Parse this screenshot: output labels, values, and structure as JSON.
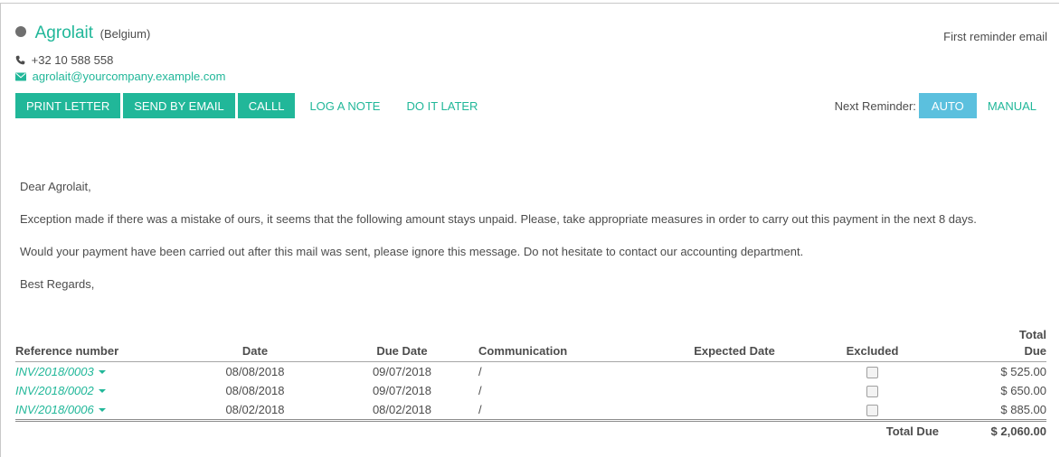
{
  "partner": {
    "name": "Agrolait",
    "country": "(Belgium)",
    "phone": "+32 10 588 558",
    "email": "agrolait@yourcompany.example.com"
  },
  "reminder_level": "First reminder email",
  "actions": {
    "print_letter": "PRINT LETTER",
    "send_by_email": "SEND BY EMAIL",
    "call": "CALLL",
    "log_note": "LOG A NOTE",
    "do_it_later": "DO IT LATER"
  },
  "next_reminder": {
    "label": "Next Reminder:",
    "auto": "AUTO",
    "manual": "MANUAL"
  },
  "letter": {
    "greeting": "Dear Agrolait,",
    "paragraph1": "Exception made if there was a mistake of ours, it seems that the following amount stays unpaid. Please, take appropriate measures in order to carry out this payment in the next 8 days.",
    "paragraph2": "Would your payment have been carried out after this mail was sent, please ignore this message. Do not hesitate to contact our accounting department.",
    "closing": "Best Regards,"
  },
  "table": {
    "headers": {
      "reference": "Reference number",
      "date": "Date",
      "due_date": "Due Date",
      "communication": "Communication",
      "expected_date": "Expected Date",
      "excluded": "Excluded",
      "total_due_line1": "Total",
      "total_due_line2": "Due"
    },
    "rows": [
      {
        "reference": "INV/2018/0003",
        "date": "08/08/2018",
        "due_date": "09/07/2018",
        "communication": "/",
        "expected_date": "",
        "total_due": "$ 525.00"
      },
      {
        "reference": "INV/2018/0002",
        "date": "08/08/2018",
        "due_date": "09/07/2018",
        "communication": "/",
        "expected_date": "",
        "total_due": "$ 650.00"
      },
      {
        "reference": "INV/2018/0006",
        "date": "08/02/2018",
        "due_date": "08/02/2018",
        "communication": "/",
        "expected_date": "",
        "total_due": "$ 885.00"
      }
    ],
    "total_label": "Total Due",
    "total_value": "$ 2,060.00"
  },
  "colors": {
    "accent": "#21b799",
    "info": "#5bc0de",
    "status_dot": "#6f6f6f"
  },
  "icons": {
    "status": "status-dot-icon",
    "phone": "phone-icon",
    "email": "envelope-icon",
    "dropdown": "caret-down-icon"
  }
}
